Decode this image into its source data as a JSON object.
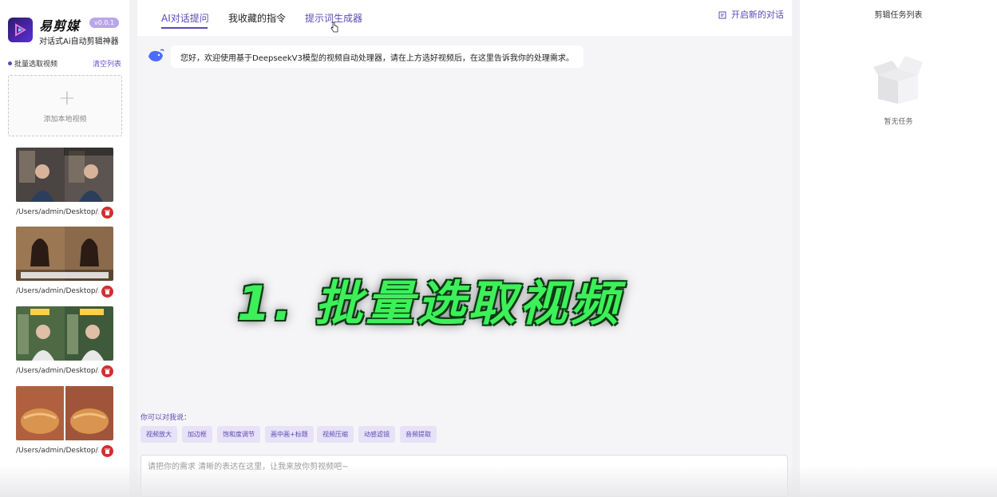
{
  "app": {
    "name": "易剪媒",
    "version": "v0.0.1",
    "subtitle": "对话式Ai自动剪辑神器"
  },
  "sidebar": {
    "select_label": "批量选取视频",
    "clear_label": "清空列表",
    "add_label": "添加本地视频",
    "videos": [
      {
        "path": "/Users/admin/Desktop/..."
      },
      {
        "path": "/Users/admin/Desktop/..."
      },
      {
        "path": "/Users/admin/Desktop/..."
      },
      {
        "path": "/Users/admin/Desktop/..."
      }
    ]
  },
  "tabs": [
    {
      "label": "AI对话提问"
    },
    {
      "label": "我收藏的指令"
    },
    {
      "label": "提示词生成器"
    }
  ],
  "new_chat_label": "开启新的对话",
  "chat": {
    "welcome": "您好，欢迎使用基于DeepseekV3模型的视频自动处理器，请在上方选好视频后，在这里告诉我你的处理需求。"
  },
  "overlay_caption": "1. 批量选取视频",
  "suggestions": {
    "label": "你可以对我说：",
    "chips": [
      "视频放大",
      "加边框",
      "饱和度调节",
      "画中画+标题",
      "视频压缩",
      "动感滤镜",
      "音频提取"
    ]
  },
  "input": {
    "placeholder": "请把你的需求 清晰的表达在这里，让我来放你剪视频吧~"
  },
  "tasks": {
    "title": "剪辑任务列表",
    "empty_text": "暂无任务"
  },
  "colors": {
    "accent": "#5a4bb5",
    "delete": "#d32f2f",
    "caption": "#3df05a"
  }
}
